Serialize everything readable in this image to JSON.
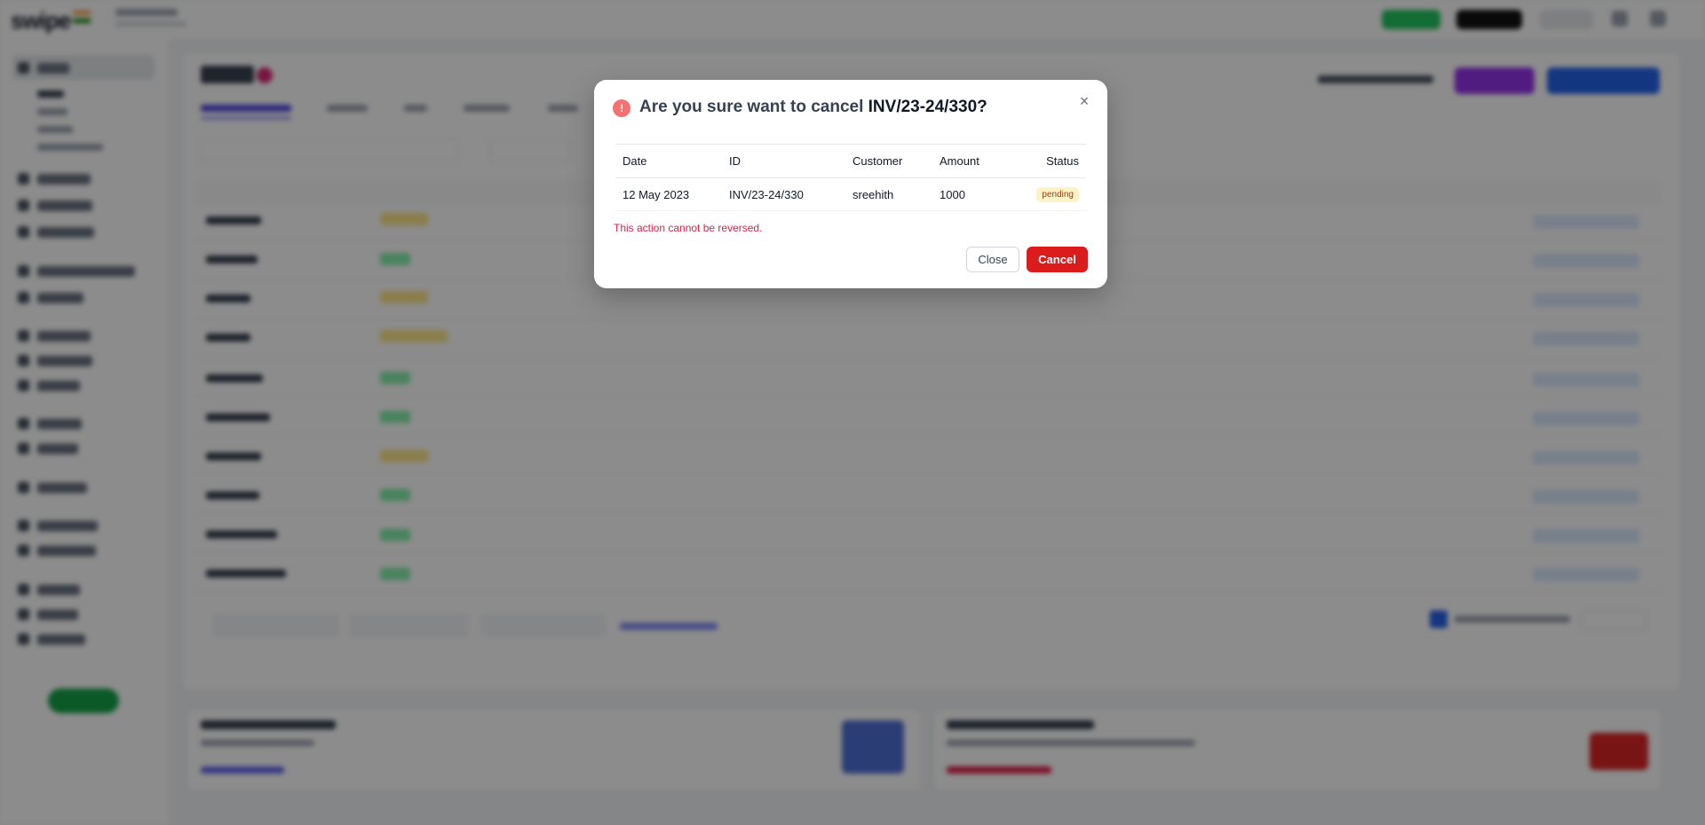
{
  "app": {
    "logo_text": "swipe",
    "page_title": "Sales",
    "first_tab": "All Transactions"
  },
  "modal": {
    "title_prefix": "Are you sure want to cancel ",
    "title_invoice": "INV/23-24/330?",
    "warn_icon": "!",
    "close_icon": "×",
    "columns": [
      "Date",
      "ID",
      "Customer",
      "Amount",
      "Status"
    ],
    "row": {
      "date": "12 May 2023",
      "id": "INV/23-24/330",
      "customer": "sreehith",
      "amount": "1000",
      "status": "pending"
    },
    "warning_text": "This action cannot be reversed.",
    "close_label": "Close",
    "cancel_label": "Cancel"
  },
  "colors": {
    "primary_action": "#dc1c1c",
    "warning_text": "#e11d48",
    "pending_badge": "#fef3c7",
    "brand_blue": "#2563eb",
    "brand_purple": "#9333ea"
  }
}
